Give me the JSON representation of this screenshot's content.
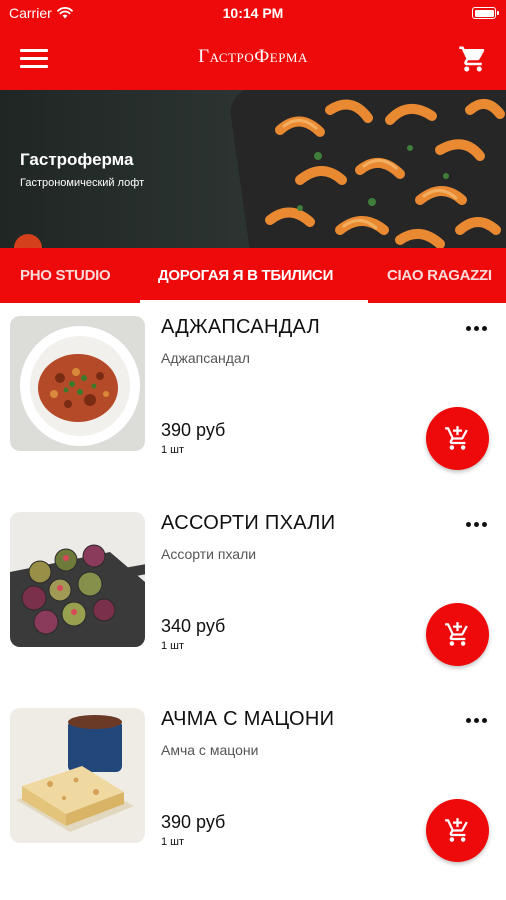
{
  "status_bar": {
    "carrier": "Carrier",
    "time": "10:14 PM"
  },
  "app_bar": {
    "title": "ГастроФерма"
  },
  "hero": {
    "title": "Гастроферма",
    "subtitle": "Гастрономический лофт"
  },
  "tabs": [
    {
      "label": "PHO STUDIO",
      "selected": false
    },
    {
      "label": "ДОРОГАЯ Я В ТБИЛИСИ",
      "selected": true
    },
    {
      "label": "CIAO RAGAZZI",
      "selected": false
    }
  ],
  "items": [
    {
      "name": "АДЖАПСАНДАЛ",
      "description": "Аджапсандал",
      "price": "390 руб",
      "qty": "1 шт"
    },
    {
      "name": "АССОРТИ ПХАЛИ",
      "description": "Ассорти пхали",
      "price": "340 руб",
      "qty": "1 шт"
    },
    {
      "name": "АЧМА С МАЦОНИ",
      "description": "Амча с мацони",
      "price": "390 руб",
      "qty": "1 шт"
    }
  ],
  "colors": {
    "accent": "#ee0a0a",
    "text": "#111111",
    "secondary_text": "#555555"
  },
  "icons": {
    "menu": "hamburger-icon",
    "cart": "cart-icon",
    "more": "more-horizontal-icon",
    "add_to_cart": "add-shopping-cart-icon"
  }
}
